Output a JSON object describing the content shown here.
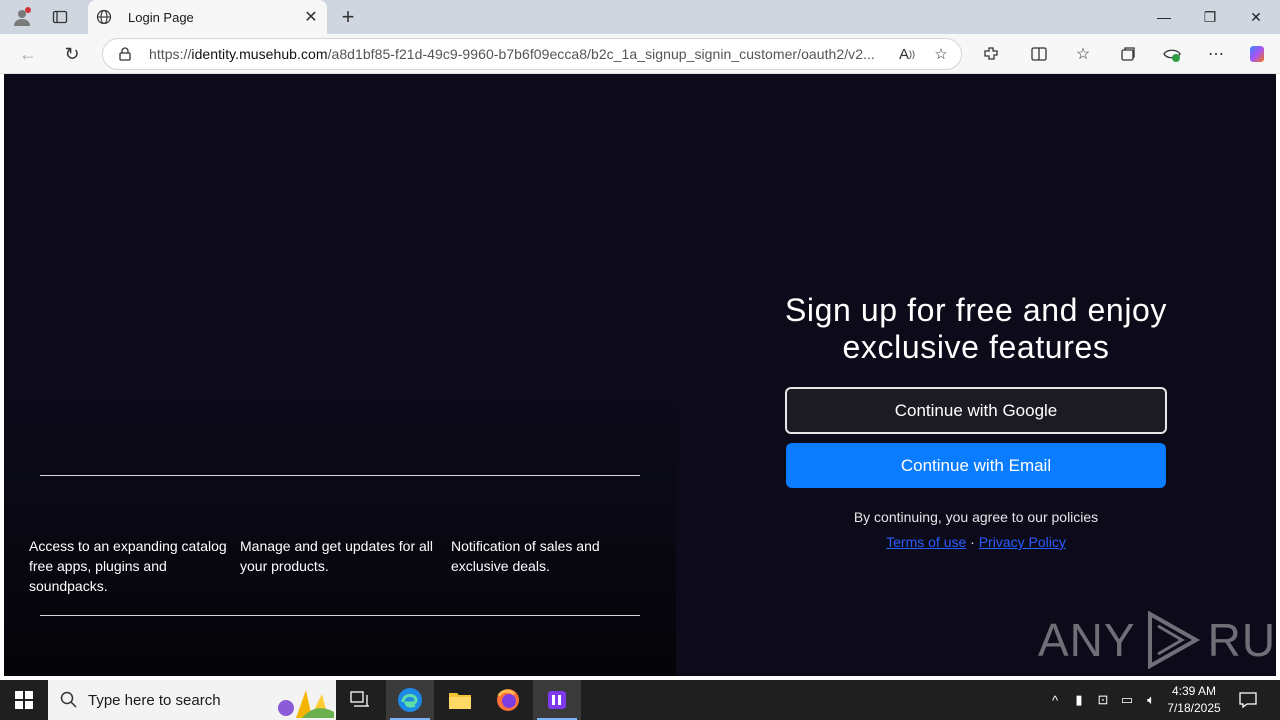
{
  "browser": {
    "tab_title": "Login Page",
    "url_prefix": "https://",
    "url_host": "identity.musehub.com",
    "url_path": "/a8d1bf85-f21d-49c9-9960-b7b6f09ecca8/b2c_1a_signup_signin_customer/oauth2/v2..."
  },
  "page": {
    "heading": "Sign up for free and enjoy exclusive features",
    "google_button": "Continue with Google",
    "email_button": "Continue with Email",
    "policy_text": "By continuing, you agree to our policies",
    "terms_link": "Terms of use",
    "separator": "·",
    "privacy_link": "Privacy Policy",
    "features": [
      "Access to an expanding catalog free apps, plugins and soundpacks.",
      "Manage and get updates for all your products.",
      "Notification of sales and exclusive deals."
    ],
    "watermark_left": "ANY",
    "watermark_right": "RUN"
  },
  "taskbar": {
    "search_placeholder": "Type here to search",
    "time": "4:39 AM",
    "date": "7/18/2025"
  },
  "colors": {
    "page_bg": "#0d0b1a",
    "email_button": "#0a7cff",
    "link": "#2a5cff"
  }
}
